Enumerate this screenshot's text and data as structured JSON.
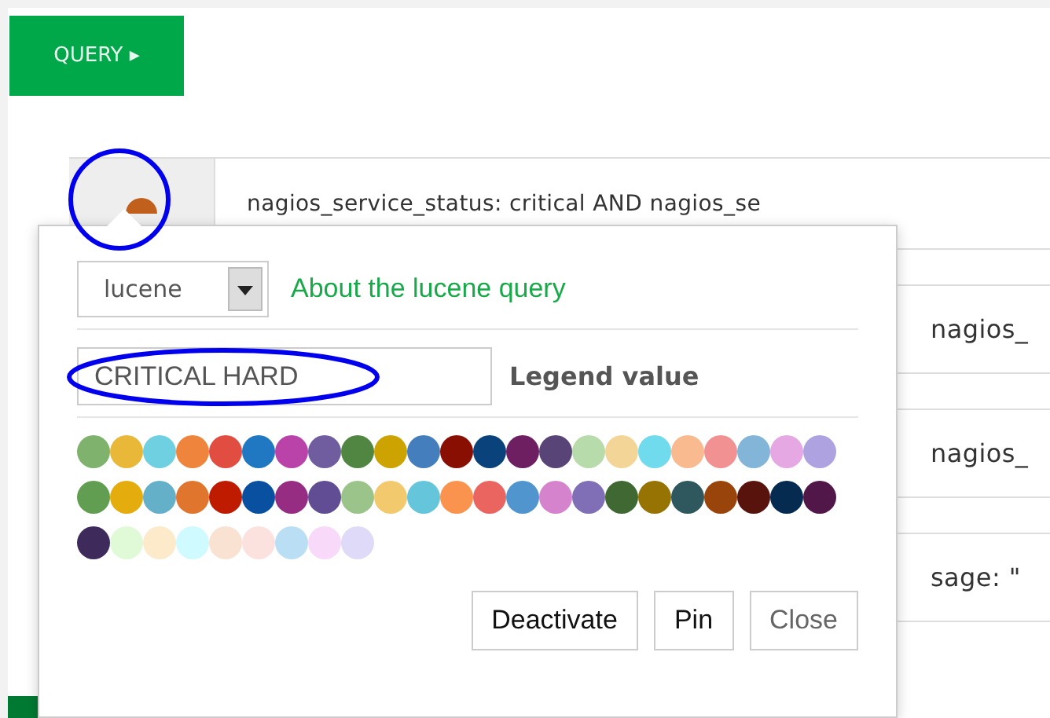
{
  "query_button": {
    "label": "QUERY",
    "icon": "▸"
  },
  "query_rows": [
    {
      "text": "nagios_service_status: critical AND nagios_se"
    },
    {
      "text": "nagios_"
    },
    {
      "text": "nagios_"
    },
    {
      "text": "sage: \""
    }
  ],
  "popover": {
    "query_type": "lucene",
    "help_link": "About the lucene query",
    "legend_input": {
      "value": "CRITICAL HARD"
    },
    "legend_label": "Legend value",
    "swatch_rows": [
      {
        "swatches": [
          {
            "color": "#7eb26d"
          },
          {
            "color": "#eab839"
          },
          {
            "color": "#6ed0e0"
          },
          {
            "color": "#ef843c"
          },
          {
            "color": "#e24d42"
          },
          {
            "color": "#1f78c1"
          },
          {
            "color": "#ba43a9"
          },
          {
            "color": "#705da0"
          },
          {
            "color": "#508642"
          },
          {
            "color": "#cca300"
          },
          {
            "color": "#447ebc"
          },
          {
            "color": "#890f02"
          },
          {
            "color": "#0a437c"
          },
          {
            "color": "#6d1f62"
          },
          {
            "color": "#584477"
          },
          {
            "color": "#b7dbab"
          },
          {
            "color": "#f4d598"
          },
          {
            "color": "#70dbed"
          },
          {
            "color": "#f9ba8f"
          },
          {
            "color": "#f29191"
          },
          {
            "color": "#82b5d8"
          },
          {
            "color": "#e5a8e2"
          },
          {
            "color": "#aea2e0"
          }
        ]
      },
      {
        "swatches": [
          {
            "color": "#629e51"
          },
          {
            "color": "#e5ac0e"
          },
          {
            "color": "#64b0c8"
          },
          {
            "color": "#e0752d"
          },
          {
            "color": "#bf1b00"
          },
          {
            "color": "#0a50a1"
          },
          {
            "color": "#962d82"
          },
          {
            "color": "#614d93"
          },
          {
            "color": "#9ac48a"
          },
          {
            "color": "#f2c96d"
          },
          {
            "color": "#65c5db"
          },
          {
            "color": "#f9934e"
          },
          {
            "color": "#ea6460"
          },
          {
            "color": "#5195ce"
          },
          {
            "color": "#d683ce"
          },
          {
            "color": "#806eb7"
          },
          {
            "color": "#3f6833"
          },
          {
            "color": "#967302"
          },
          {
            "color": "#2f575e"
          },
          {
            "color": "#99440a"
          },
          {
            "color": "#58140c"
          },
          {
            "color": "#052b51"
          },
          {
            "color": "#511749"
          }
        ]
      },
      {
        "swatches": [
          {
            "color": "#3f2b5b"
          },
          {
            "color": "#e0f9d7"
          },
          {
            "color": "#fceaca"
          },
          {
            "color": "#cffaff"
          },
          {
            "color": "#f9e2d2"
          },
          {
            "color": "#fce2de"
          },
          {
            "color": "#badff4"
          },
          {
            "color": "#f9d9f9"
          },
          {
            "color": "#dedaf7"
          }
        ]
      }
    ],
    "buttons": [
      {
        "label": "Deactivate"
      },
      {
        "label": "Pin"
      },
      {
        "label": "Close"
      }
    ]
  }
}
